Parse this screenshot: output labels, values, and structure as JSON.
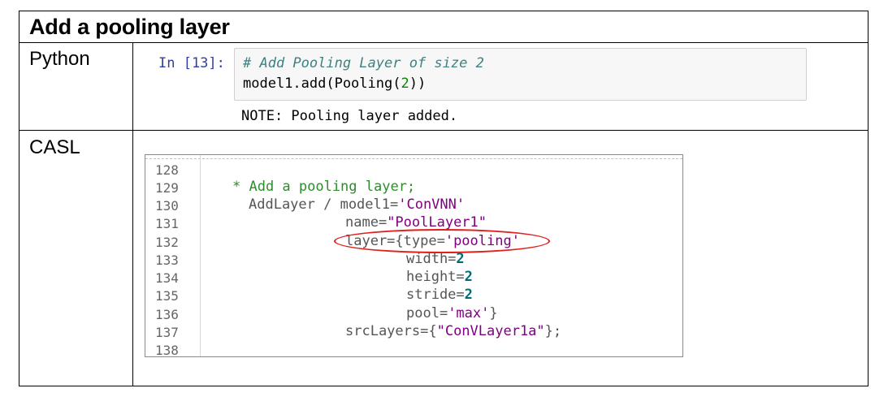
{
  "title": "Add a pooling layer",
  "python": {
    "label": "Python",
    "prompt": "In [13]:",
    "comment": "# Add Pooling Layer of size 2",
    "code_prefix": "model1.add(Pooling(",
    "code_num": "2",
    "code_suffix": "))",
    "output": "NOTE: Pooling layer added."
  },
  "casl": {
    "label": "CASL",
    "line_numbers": [
      "128",
      "129",
      "130",
      "131",
      "132",
      "133",
      "134",
      "135",
      "136",
      "137",
      "138"
    ],
    "lines": {
      "l129": "* Add a pooling layer;",
      "l130_a": "AddLayer / model1=",
      "l130_b": "'ConVNN'",
      "l131_a": "name=",
      "l131_b": "\"PoolLayer1\"",
      "l132_a": "layer={type=",
      "l132_b": "'pooling'",
      "l133_a": "width=",
      "l133_b": "2",
      "l134_a": "height=",
      "l134_b": "2",
      "l135_a": "stride=",
      "l135_b": "2",
      "l136_a": "pool=",
      "l136_b": "'max'",
      "l136_c": "}",
      "l137_a": "srcLayers={",
      "l137_b": "\"ConVLayer1a\"",
      "l137_c": "};"
    }
  },
  "colors": {
    "highlight": "#e0201c",
    "prompt": "#303f9f",
    "comment": "#408080",
    "string": "#800080",
    "number": "#006d75"
  }
}
